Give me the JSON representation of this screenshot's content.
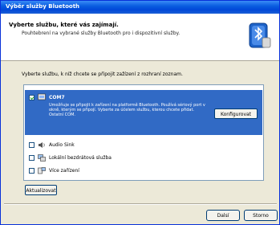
{
  "window": {
    "title": "Výběr služby Bluetooth"
  },
  "header": {
    "title": "Vyberte službu, které vás zajímají.",
    "subtitle": "Pouhtebrení na vybrané služby Bluetooth pro i dispozitivní služby."
  },
  "list": {
    "description": "Vyberte službu, k níž chcete se připojit zažízení z rozhraní  zoznam.",
    "selected_item": {
      "label": "COM7",
      "description": "Umožňuje se připojit k zařízení na platformě Bluetooth. Používá sériový port v okně, kterým se připojí. Vyberte za účelem službu, kterou chcete přidat. Ostatní COM.",
      "checked": true,
      "icon": "serial-port-icon"
    },
    "configure_label": "Konfigurovat",
    "items": [
      {
        "label": "Audio Sink",
        "checked": false,
        "icon": "audio-icon"
      },
      {
        "label": "Lokální bezdrátová služba",
        "checked": false,
        "icon": "network-icon"
      },
      {
        "label": "Více zařízení",
        "checked": false,
        "icon": "device-icon"
      }
    ]
  },
  "buttons": {
    "refresh": "Aktualizovat",
    "next": "Dalsí",
    "cancel": "Storno"
  },
  "colors": {
    "selection": "#316AC5",
    "titlebar": "#0A5DE0"
  }
}
